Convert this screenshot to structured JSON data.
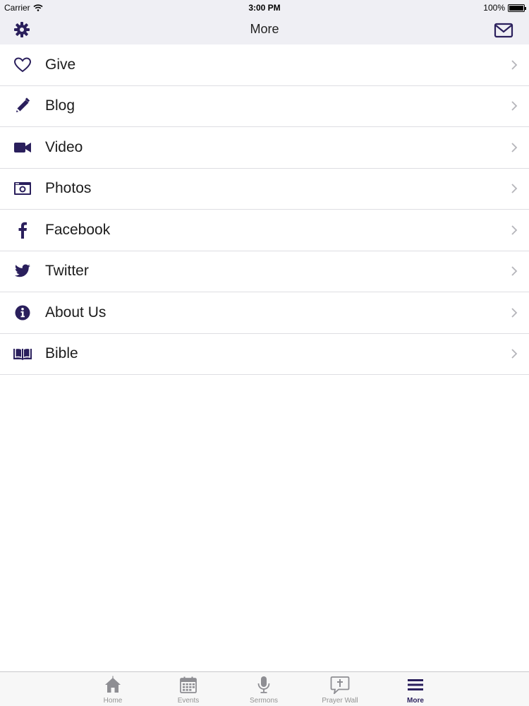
{
  "status_bar": {
    "carrier": "Carrier",
    "time": "3:00 PM",
    "battery": "100%"
  },
  "nav": {
    "title": "More",
    "left_icon": "gear-icon",
    "right_icon": "mail-icon"
  },
  "menu": {
    "items": [
      {
        "label": "Give",
        "icon": "heart-icon"
      },
      {
        "label": "Blog",
        "icon": "pencil-icon"
      },
      {
        "label": "Video",
        "icon": "video-camera-icon"
      },
      {
        "label": "Photos",
        "icon": "camera-icon"
      },
      {
        "label": "Facebook",
        "icon": "facebook-icon"
      },
      {
        "label": "Twitter",
        "icon": "twitter-icon"
      },
      {
        "label": "About Us",
        "icon": "info-icon"
      },
      {
        "label": "Bible",
        "icon": "book-icon"
      }
    ]
  },
  "tab_bar": {
    "tabs": [
      {
        "label": "Home",
        "icon": "home-icon",
        "active": false
      },
      {
        "label": "Events",
        "icon": "calendar-icon",
        "active": false
      },
      {
        "label": "Sermons",
        "icon": "microphone-icon",
        "active": false
      },
      {
        "label": "Prayer Wall",
        "icon": "prayer-bubble-icon",
        "active": false
      },
      {
        "label": "More",
        "icon": "menu-icon",
        "active": true
      }
    ]
  },
  "colors": {
    "accent": "#2a1f5c",
    "bar_background": "#efeff4",
    "inactive_tab": "#929292",
    "separator": "#dedee2"
  }
}
